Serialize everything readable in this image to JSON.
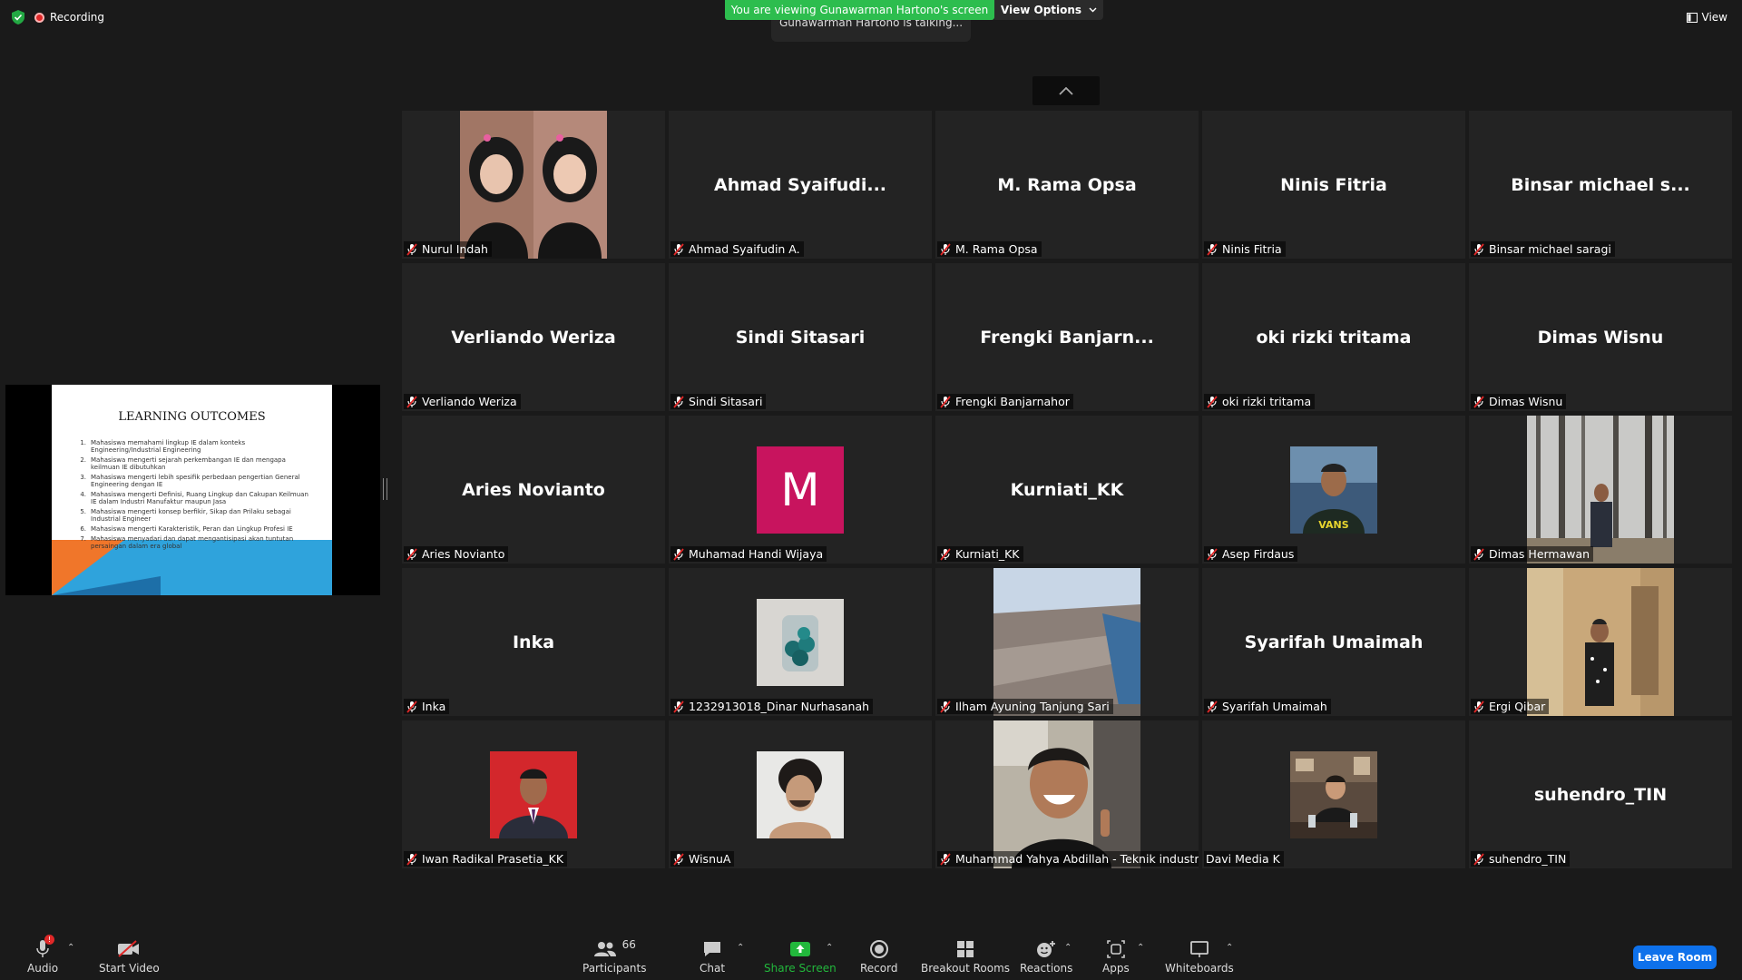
{
  "top": {
    "recording_label": "Recording",
    "viewing_banner": "You are viewing Gunawarman Hartono's screen",
    "view_options": "View Options",
    "talking": "Gunawarman Hartono is talking...",
    "view_label": "View"
  },
  "slide": {
    "title": "LEARNING OUTCOMES",
    "items": [
      {
        "n": "1.",
        "text": "Mahasiswa memahami lingkup IE dalam konteks Engineering/Industrial Engineering"
      },
      {
        "n": "2.",
        "text": "Mahasiswa mengerti sejarah perkembangan IE dan mengapa keilmuan IE dibutuhkan"
      },
      {
        "n": "3.",
        "text": "Mahasiswa mengerti lebih spesifik perbedaan pengertian General Engineering dengan IE"
      },
      {
        "n": "4.",
        "text": "Mahasiswa mengerti Definisi, Ruang Lingkup dan Cakupan Keilmuan IE dalam Industri Manufaktur maupun Jasa"
      },
      {
        "n": "5.",
        "text": "Mahasiswa mengerti konsep berfikir, Sikap dan Prilaku sebagai Industrial Engineer"
      },
      {
        "n": "6.",
        "text": "Mahasiswa mengerti Karakteristik, Peran dan Lingkup Profesi IE"
      },
      {
        "n": "7.",
        "text": "Mahasiswa menyadari dan dapat mengantisipasi akan tuntutan persaingan dalam era global"
      }
    ]
  },
  "tiles": [
    {
      "label": "Nurul Indah",
      "big": "",
      "kind": "photo-hijab"
    },
    {
      "label": "Ahmad Syaifudin A.",
      "big": "Ahmad  Syaifudi..."
    },
    {
      "label": "M. Rama Opsa",
      "big": "M. Rama Opsa"
    },
    {
      "label": "Ninis Fitria",
      "big": "Ninis Fitria"
    },
    {
      "label": "Binsar michael saragi",
      "big": "Binsar michael s..."
    },
    {
      "label": "Verliando Weriza",
      "big": "Verliando Weriza"
    },
    {
      "label": "Sindi Sitasari",
      "big": "Sindi Sitasari"
    },
    {
      "label": "Frengki Banjarnahor",
      "big": "Frengki  Banjarn..."
    },
    {
      "label": "oki rizki tritama",
      "big": "oki rizki tritama"
    },
    {
      "label": "Dimas Wisnu",
      "big": "Dimas Wisnu"
    },
    {
      "label": "Aries Novianto",
      "big": "Aries Novianto"
    },
    {
      "label": "Muhamad Handi Wijaya",
      "big": "",
      "avatar_letter": "M"
    },
    {
      "label": "Kurniati_KK",
      "big": "Kurniati_KK"
    },
    {
      "label": "Asep Firdaus",
      "big": "",
      "kind": "photo-small"
    },
    {
      "label": "Dimas Hermawan",
      "big": "",
      "kind": "photo-forest"
    },
    {
      "label": "Inka",
      "big": "Inka"
    },
    {
      "label": "1232913018_Dinar Nurhasanah",
      "big": "",
      "kind": "photo-jar"
    },
    {
      "label": "Ilham Ayuning Tanjung Sari",
      "big": "",
      "kind": "photo-city"
    },
    {
      "label": "Syarifah Umaimah",
      "big": "Syarifah Umaimah"
    },
    {
      "label": "Ergi Qibar",
      "big": "",
      "kind": "photo-mirror"
    },
    {
      "label": "Iwan Radikal Prasetia_KK",
      "big": "",
      "kind": "photo-red"
    },
    {
      "label": "WisnuA",
      "big": "",
      "kind": "photo-portrait"
    },
    {
      "label": "Muhammad Yahya Abdillah - Teknik industri",
      "big": "",
      "kind": "photo-smile"
    },
    {
      "label": "Davi Media K",
      "big": "",
      "kind": "photo-cafe",
      "unmuted": true
    },
    {
      "label": "suhendro_TIN",
      "big": "suhendro_TIN"
    }
  ],
  "toolbar": {
    "audio": "Audio",
    "audio_badge": "!",
    "start_video": "Start Video",
    "participants": "Participants",
    "participants_count": "66",
    "chat": "Chat",
    "share_screen": "Share Screen",
    "record": "Record",
    "breakout_rooms": "Breakout Rooms",
    "reactions": "Reactions",
    "apps": "Apps",
    "whiteboards": "Whiteboards",
    "leave_room": "Leave Room"
  },
  "colors": {
    "banner_green": "#2dbd4e",
    "leave_blue": "#0e71eb",
    "share_green": "#22b83c",
    "avatar_magenta": "#c8145e",
    "mute_red": "#e02828"
  }
}
